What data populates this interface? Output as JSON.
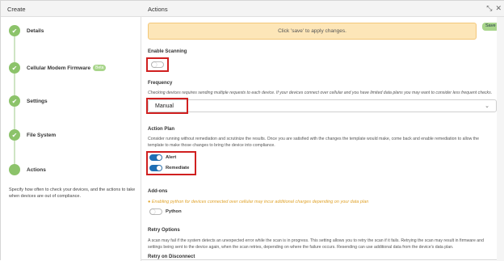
{
  "headers": {
    "left": "Create",
    "right": "Actions"
  },
  "steps": [
    {
      "label": "Details"
    },
    {
      "label": "Cellular Modem Firmware",
      "badge": "Beta"
    },
    {
      "label": "Settings"
    },
    {
      "label": "File System"
    },
    {
      "label": "Actions"
    }
  ],
  "step_desc": "Specify how often to check your devices, and the actions to take when devices are out of compliance.",
  "banner": "Click 'save' to apply changes.",
  "save_label": "Save",
  "scan": {
    "title": "Enable Scanning",
    "enabled": false
  },
  "frequency": {
    "title": "Frequency",
    "help": "Checking devices requires sending multiple requests to each device. If your devices connect over cellular and you have limited data plans you may want to consider less frequent checks.",
    "value": "Manual"
  },
  "action_plan": {
    "title": "Action Plan",
    "help": "Consider running without remediation and scrutinize the results. Once you are satisfied with the changes the template would make, come back and enable remediation to allow the template to make those changes to bring the device into compliance.",
    "alert_label": "Alert",
    "alert_on": true,
    "remediate_label": "Remediate",
    "remediate_on": true
  },
  "addons": {
    "title": "Add-ons",
    "warning": "Enabling python for devices connected over cellular may incur additional charges depending on your data plan",
    "python_label": "Python",
    "python_on": false
  },
  "retry": {
    "title": "Retry Options",
    "help": "A scan may fail if the system detects an unexpected error while the scan is in progress. This setting allows you to retry the scan if it fails. Retrying the scan may result in firmware and settings being sent to the device again, when the scan retries, depending on where the failure occurs. Resending can use additional data from the device's data plan.",
    "disconnect_title": "Retry on Disconnect"
  },
  "icons": {
    "check": "check-icon",
    "chevron": "chevron-down-icon",
    "warning": "warning-icon"
  },
  "colors": {
    "step_green": "#8cc36a",
    "toggle_blue": "#1f6fb5",
    "banner_bg": "#fde6b8",
    "highlight_red": "#d02020"
  }
}
